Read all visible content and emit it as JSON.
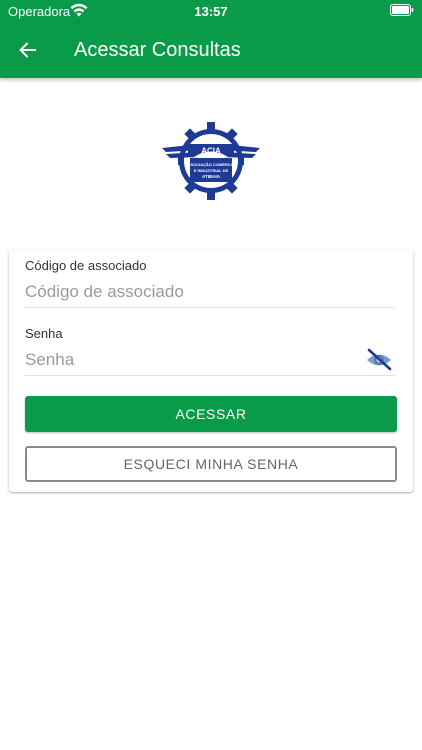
{
  "status_bar": {
    "carrier": "Operadora",
    "time": "13:57",
    "wifi_icon": "wifi-icon",
    "battery_icon": "battery-full-icon"
  },
  "app_bar": {
    "title": "Acessar Consultas",
    "back_icon": "arrow-left-icon",
    "color": "#0a9b4a"
  },
  "logo": {
    "name": "acia-logo",
    "text_top": "ACIA",
    "text_lines": [
      "ASSOCIAÇÃO COMERCIAL",
      "E INDUSTRIAL DE",
      "ATIBAIA"
    ]
  },
  "form": {
    "code": {
      "label": "Código de associado",
      "placeholder": "Código de associado",
      "value": ""
    },
    "password": {
      "label": "Senha",
      "placeholder": "Senha",
      "value": "",
      "toggle_icon": "eye-off-icon"
    },
    "submit_label": "ACESSAR",
    "forgot_label": "ESQUECI MINHA SENHA"
  },
  "colors": {
    "primary": "#0a9b4a",
    "logo_blue": "#1f3a93"
  }
}
